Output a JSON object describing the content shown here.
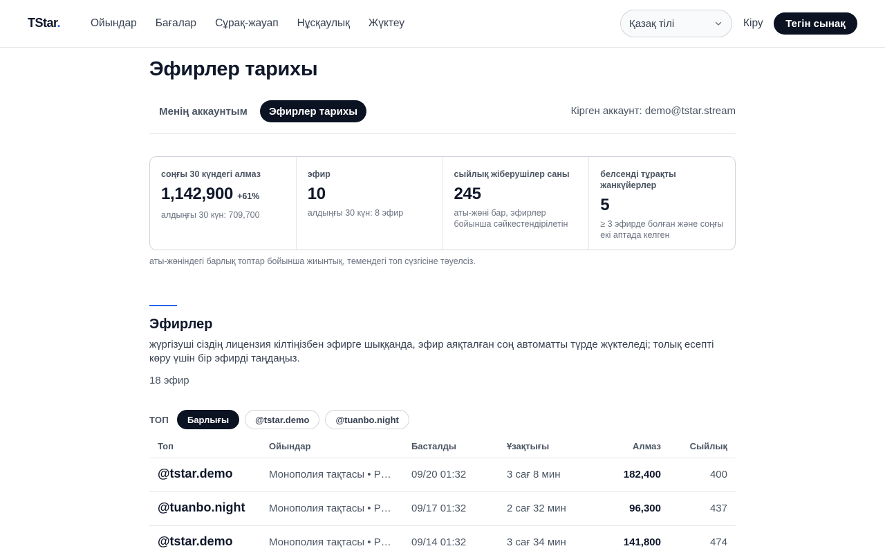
{
  "header": {
    "logo": "TStar",
    "logo_dot": ".",
    "nav": [
      "Ойындар",
      "Бағалар",
      "Сұрақ-жауап",
      "Нұсқаулық",
      "Жүктеу"
    ],
    "language": "Қазақ тілі",
    "login": "Кіру",
    "trial": "Тегін сынақ"
  },
  "page": {
    "title": "Эфирлер тарихы",
    "tabs": [
      "Менің аккаунтым",
      "Эфирлер тарихы"
    ],
    "active_tab": "Эфирлер тарихы",
    "account_info": "Кірген аккаунт: demo@tstar.stream"
  },
  "stats": [
    {
      "label": "соңғы 30 күндегі алмаз",
      "value": "1,142,900",
      "delta": "+61%",
      "sub": "алдыңғы 30 күн: 709,700"
    },
    {
      "label": "эфир",
      "value": "10",
      "sub": "алдыңғы 30 күн: 8 эфир"
    },
    {
      "label": "сыйлық жіберушілер саны",
      "value": "245",
      "sub": "аты-жөні бар, эфирлер бойынша сәйкестендірілетін"
    },
    {
      "label": "белсенді тұрақты жанкүйерлер",
      "value": "5",
      "sub": "≥ 3 эфирде болған және соңғы екі аптада келген"
    }
  ],
  "stats_note": "аты-жөніндегі барлық топтар бойынша жиынтық, төмендегі топ сүзгісіне тәуелсіз.",
  "section": {
    "title": "Эфирлер",
    "description": "жүргізуші сіздің лицензия кілтіңізбен эфирге шыққанда, эфир аяқталған соң автоматты түрде жүктеледі; толық есепті көру үшін бір эфирді таңдаңыз.",
    "count": "18 эфир"
  },
  "filters": {
    "label": "ТОП",
    "chips": [
      "Барлығы",
      "@tstar.demo",
      "@tuanbo.night"
    ],
    "active": "Барлығы"
  },
  "table": {
    "headers": [
      "Топ",
      "Ойындар",
      "Басталды",
      "Ұзақтығы",
      "Алмаз",
      "Сыйлық"
    ],
    "rows": [
      {
        "host": "@tstar.demo",
        "games": "Монополия тақтасы  •  Р…",
        "started": "09/20 01:32",
        "duration": "3 сағ 8 мин",
        "diamonds": "182,400",
        "gifts": "400"
      },
      {
        "host": "@tuanbo.night",
        "games": "Монополия тақтасы  •  Р…",
        "started": "09/17 01:32",
        "duration": "2 сағ 32 мин",
        "diamonds": "96,300",
        "gifts": "437"
      },
      {
        "host": "@tstar.demo",
        "games": "Монополия тақтасы  •  Р…",
        "started": "09/14 01:32",
        "duration": "3 сағ 34 мин",
        "diamonds": "141,800",
        "gifts": "474"
      }
    ]
  },
  "colors": {
    "accent": "#2563eb",
    "dark": "#0b1222"
  }
}
